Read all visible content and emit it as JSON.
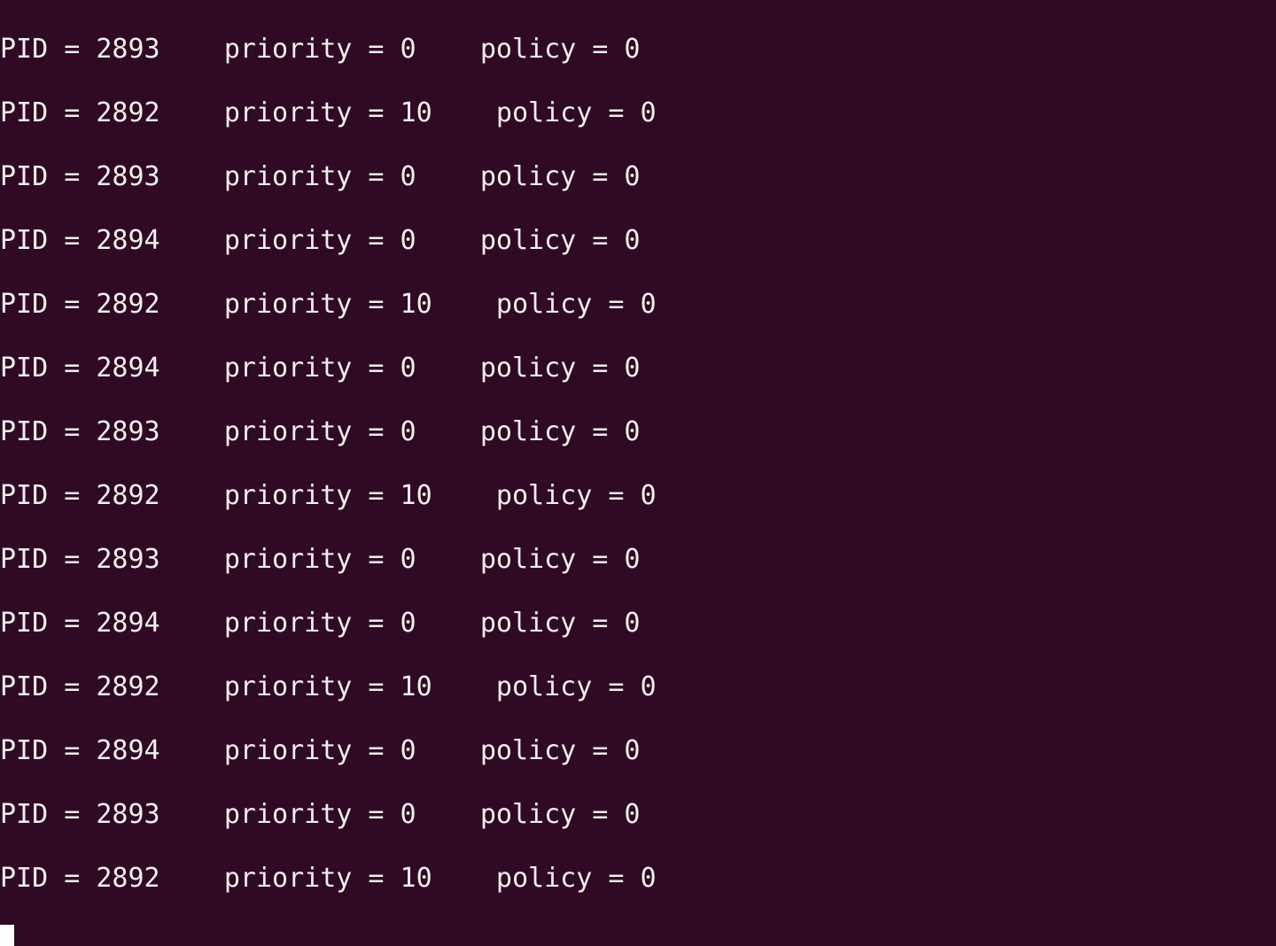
{
  "terminal": {
    "theme": {
      "background": "#300a24",
      "foreground": "#eeeeec",
      "cursor": "#ffffff"
    },
    "lines": [
      "PID = 2893    priority = 0    policy = 0",
      "PID = 2892    priority = 10    policy = 0",
      "PID = 2893    priority = 0    policy = 0",
      "PID = 2894    priority = 0    policy = 0",
      "PID = 2892    priority = 10    policy = 0",
      "PID = 2894    priority = 0    policy = 0",
      "PID = 2893    priority = 0    policy = 0",
      "PID = 2892    priority = 10    policy = 0",
      "PID = 2893    priority = 0    policy = 0",
      "PID = 2894    priority = 0    policy = 0",
      "PID = 2892    priority = 10    policy = 0",
      "PID = 2894    priority = 0    policy = 0",
      "PID = 2893    priority = 0    policy = 0",
      "PID = 2892    priority = 10    policy = 0"
    ]
  }
}
